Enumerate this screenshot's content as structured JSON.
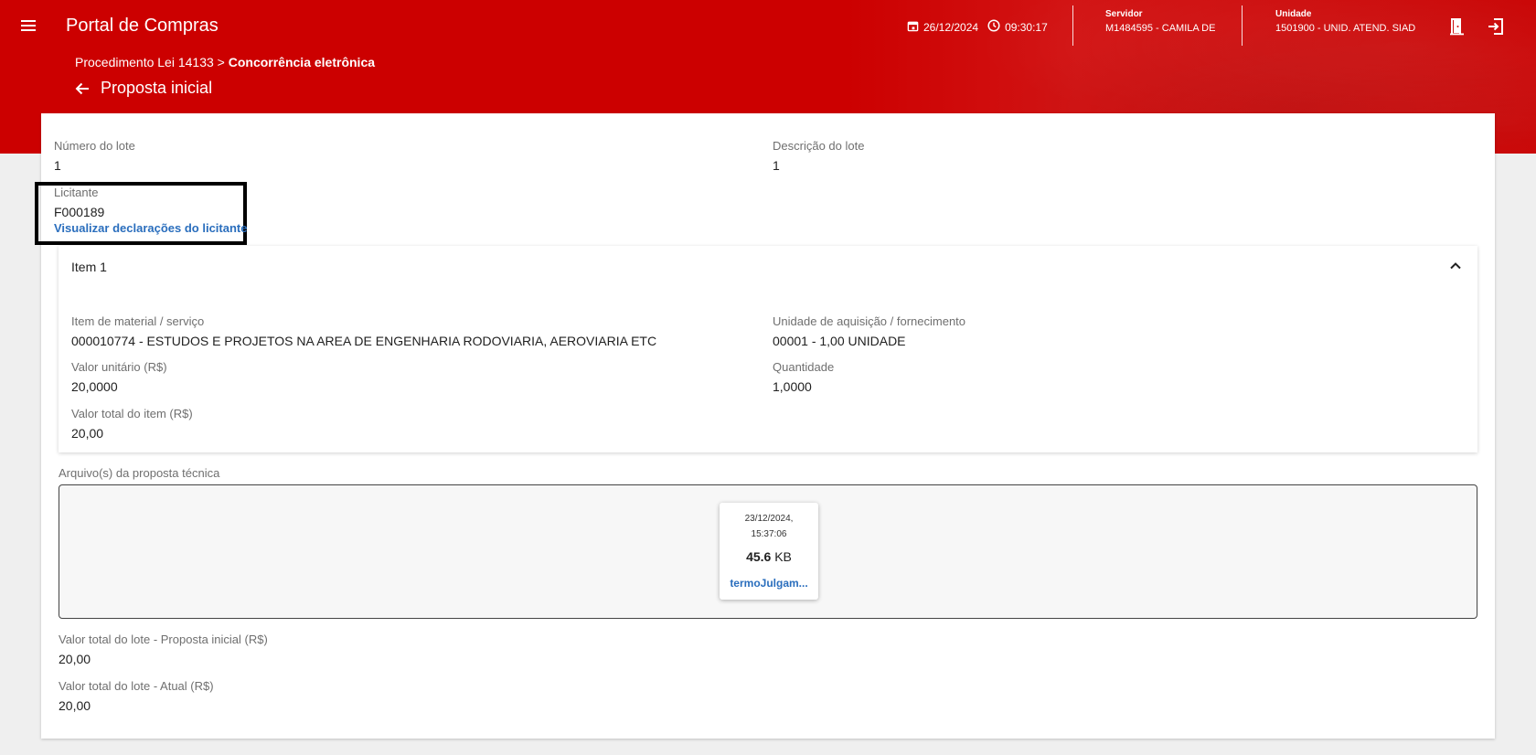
{
  "header": {
    "app_title": "Portal de Compras",
    "date": "26/12/2024",
    "time": "09:30:17",
    "servidor_label": "Servidor",
    "servidor_value": "M1484595 - CAMILA DE",
    "unidade_label": "Unidade",
    "unidade_value": "1501900 - UNID. ATEND. SIAD",
    "icons": [
      "menu-icon",
      "calendar-icon",
      "clock-icon",
      "door-icon",
      "logout-icon"
    ]
  },
  "breadcrumb": {
    "parent": "Procedimento Lei 14133 >",
    "current": "Concorrência eletrônica"
  },
  "page": {
    "title": "Proposta inicial"
  },
  "lote": {
    "numero_label": "Número do lote",
    "numero_value": "1",
    "descricao_label": "Descrição do lote",
    "descricao_value": "1",
    "licitante_label": "Licitante",
    "licitante_value": "F000189",
    "declaracoes_link": "Visualizar declarações do licitante"
  },
  "item": {
    "title": "Item 1",
    "material_label": "Item de material / serviço",
    "material_value": "000010774 - ESTUDOS E PROJETOS NA AREA DE ENGENHARIA RODOVIARIA, AEROVIARIA ETC",
    "unidade_label": "Unidade de aquisição / fornecimento",
    "unidade_value": "00001 - 1,00 UNIDADE",
    "valor_unitario_label": "Valor unitário (R$)",
    "valor_unitario_value": "20,0000",
    "quantidade_label": "Quantidade",
    "quantidade_value": "1,0000",
    "valor_total_label": "Valor total do item (R$)",
    "valor_total_value": "20,00"
  },
  "files": {
    "label": "Arquivo(s) da proposta técnica",
    "items": [
      {
        "date": "23/12/2024,",
        "time": "15:37:06",
        "size_number": "45.6",
        "size_unit": "KB",
        "name": "termoJulgam..."
      }
    ]
  },
  "totals": {
    "inicial_label": "Valor total do lote - Proposta inicial (R$)",
    "inicial_value": "20,00",
    "atual_label": "Valor total do lote - Atual (R$)",
    "atual_value": "20,00"
  },
  "colors": {
    "brand_red": "#cc0000",
    "link_blue": "#2a6ebd"
  }
}
